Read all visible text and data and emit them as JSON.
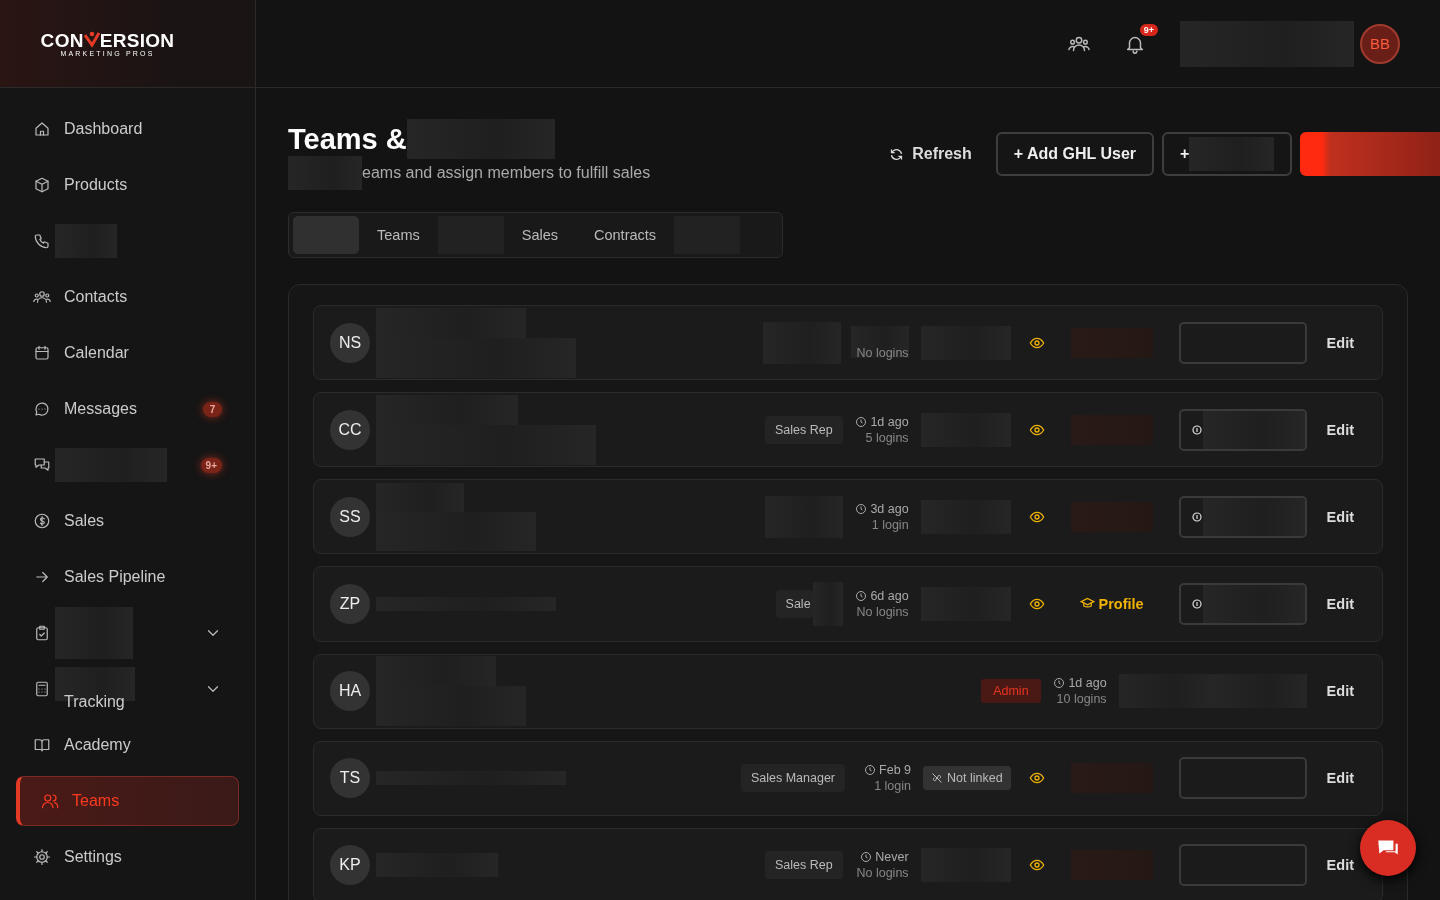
{
  "brand": {
    "name_left": "CON",
    "name_right": "ERSION",
    "tagline": "MARKETING PROS"
  },
  "sidebar": {
    "items": [
      {
        "kind": "link",
        "label": "Dashboard",
        "selected": false
      },
      {
        "kind": "link",
        "label": "Products",
        "selected": false
      },
      {
        "kind": "redacted",
        "selected": false
      },
      {
        "kind": "link",
        "label": "Contacts",
        "selected": false
      },
      {
        "kind": "link",
        "label": "Calendar",
        "selected": false
      },
      {
        "kind": "link",
        "label": "Messages",
        "badge": "7",
        "selected": false
      },
      {
        "kind": "redacted",
        "badge": "9+",
        "selected": false
      },
      {
        "kind": "link",
        "label": "Sales",
        "selected": false
      },
      {
        "kind": "link",
        "label": "Sales Pipeline",
        "selected": false
      },
      {
        "kind": "redacted",
        "expandable": true,
        "selected": false
      },
      {
        "kind": "partial",
        "label": "Tracking",
        "expandable": true,
        "selected": false
      },
      {
        "kind": "link",
        "label": "Academy",
        "selected": false
      },
      {
        "kind": "link",
        "label": "Teams",
        "selected": true
      },
      {
        "kind": "link",
        "label": "Settings",
        "selected": false
      }
    ]
  },
  "topbar": {
    "notifications": "9+",
    "avatar": "BB"
  },
  "page": {
    "title": "Teams &",
    "subtitle": "eams and assign members to fulfill sales",
    "refresh": "Refresh",
    "add_user": "+ Add GHL User",
    "second_button": "+"
  },
  "tabs": [
    {
      "kind": "redacted",
      "selected": true
    },
    {
      "kind": "tab",
      "label": "Teams",
      "selected": false
    },
    {
      "kind": "redacted",
      "selected": false
    },
    {
      "kind": "tab",
      "label": "Sales",
      "selected": false
    },
    {
      "kind": "tab",
      "label": "Contracts",
      "selected": false
    },
    {
      "kind": "redacted",
      "selected": false
    }
  ],
  "members": [
    {
      "initials": "NS",
      "edit": "Edit",
      "role": {
        "kind": "redacted"
      },
      "logins": "No logins",
      "status": {
        "kind": "redacted"
      },
      "viewable": true,
      "profile": {
        "kind": "redacted"
      },
      "action": {
        "kind": "empty"
      }
    },
    {
      "initials": "CC",
      "edit": "Edit",
      "role": {
        "kind": "badge",
        "text": "Sales Rep"
      },
      "last_seen": "1d ago",
      "logins": "5 logins",
      "status": {
        "kind": "redacted"
      },
      "viewable": true,
      "profile": {
        "kind": "redacted"
      },
      "action": {
        "kind": "linked"
      }
    },
    {
      "initials": "SS",
      "edit": "Edit",
      "role": {
        "kind": "redacted"
      },
      "last_seen": "3d ago",
      "logins": "1 login",
      "status": {
        "kind": "redacted"
      },
      "viewable": true,
      "profile": {
        "kind": "redacted"
      },
      "action": {
        "kind": "linked"
      }
    },
    {
      "initials": "ZP",
      "edit": "Edit",
      "role": {
        "kind": "partial",
        "text": "Sale"
      },
      "last_seen": "6d ago",
      "logins": "No logins",
      "status": {
        "kind": "redacted"
      },
      "viewable": true,
      "profile": {
        "kind": "link",
        "text": "Profile"
      },
      "action": {
        "kind": "linked"
      }
    },
    {
      "initials": "HA",
      "edit": "Edit",
      "role": {
        "kind": "admin",
        "text": "Admin"
      },
      "last_seen": "1d ago",
      "logins": "10 logins",
      "status": {
        "kind": "redacted"
      },
      "viewable": false,
      "profile": {
        "kind": "none"
      },
      "action": {
        "kind": "none"
      }
    },
    {
      "initials": "TS",
      "edit": "Edit",
      "role": {
        "kind": "badge",
        "text": "Sales Manager"
      },
      "last_seen": "Feb 9",
      "logins": "1 login",
      "status": {
        "kind": "unlinked",
        "text": "Not linked"
      },
      "viewable": true,
      "profile": {
        "kind": "redacted"
      },
      "action": {
        "kind": "empty"
      }
    },
    {
      "initials": "KP",
      "edit": "Edit",
      "role": {
        "kind": "badge",
        "text": "Sales Rep"
      },
      "last_seen": "Never",
      "logins": "No logins",
      "status": {
        "kind": "redacted"
      },
      "viewable": true,
      "profile": {
        "kind": "redacted"
      },
      "action": {
        "kind": "empty"
      }
    }
  ]
}
